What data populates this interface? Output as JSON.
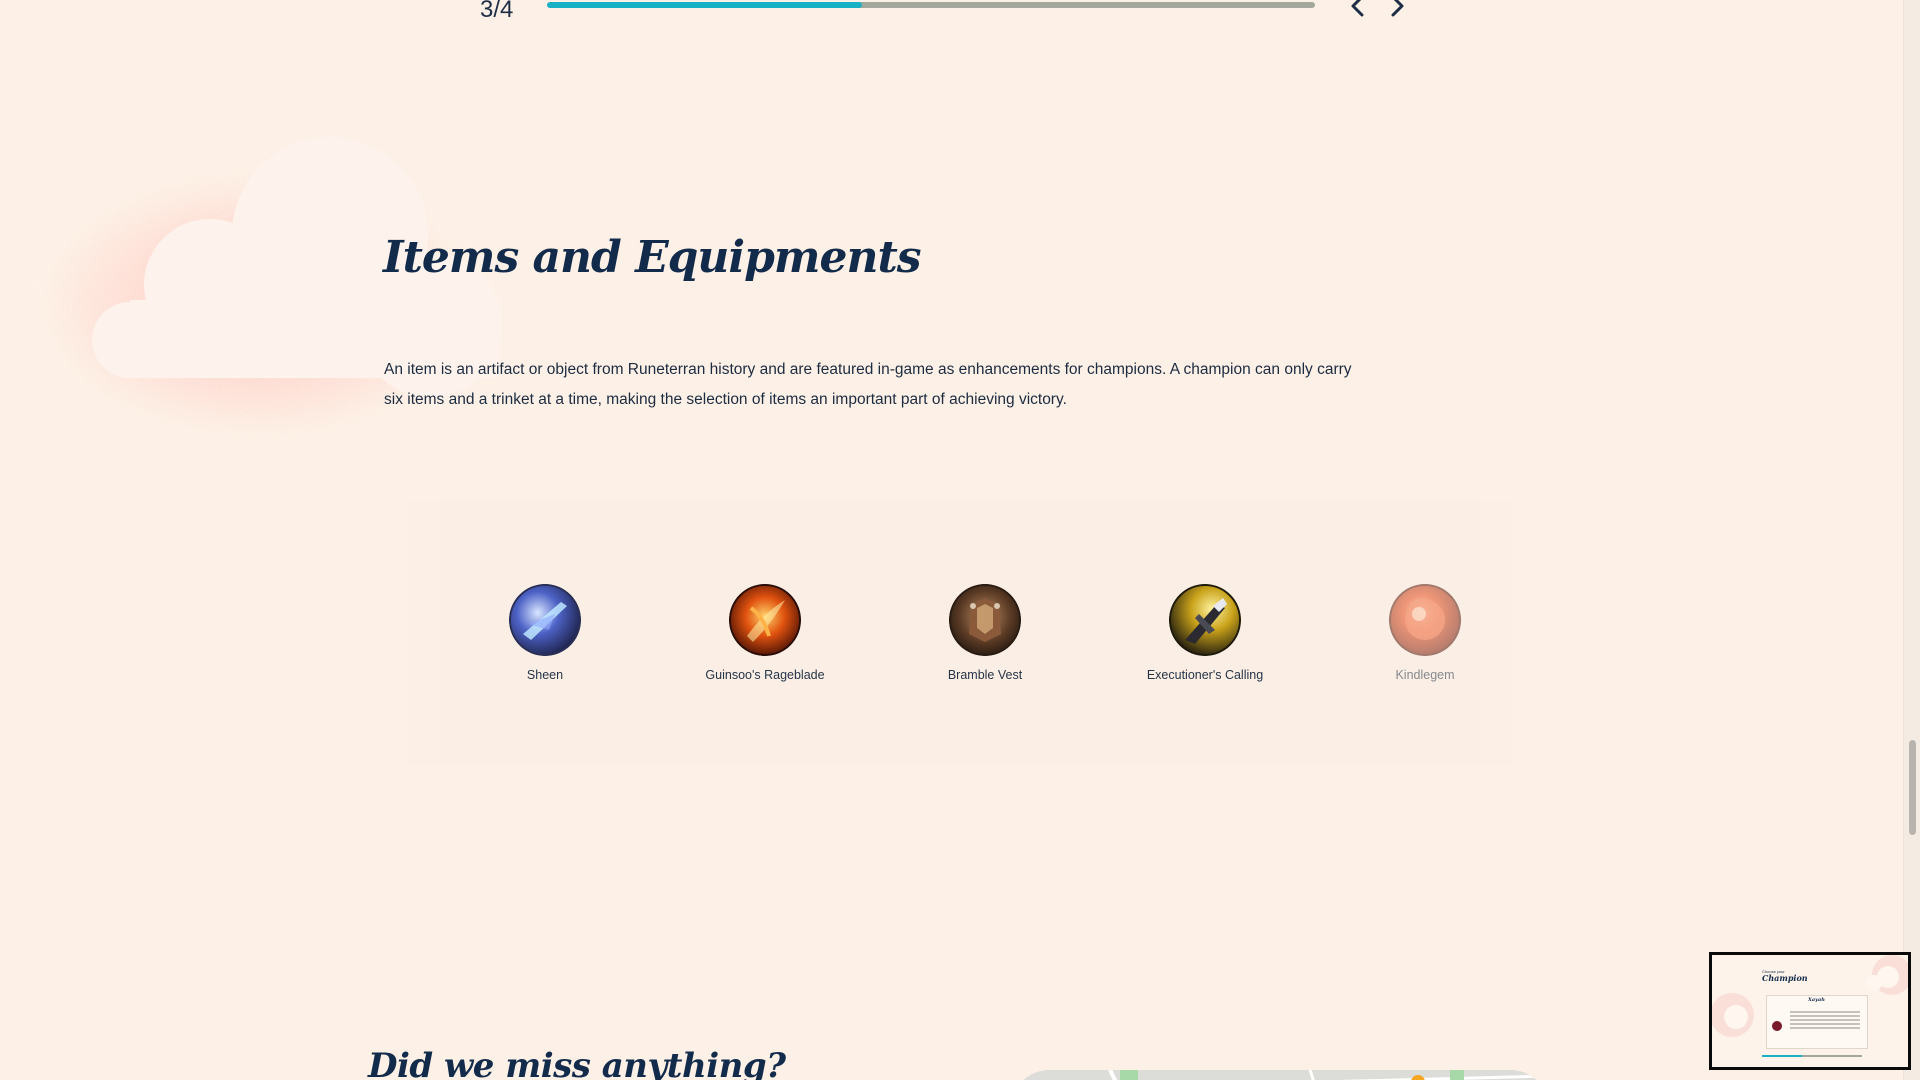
{
  "pager": {
    "count_text": "3/4",
    "progress": 0.41,
    "prev_icon": "chevron-left-icon",
    "next_icon": "chevron-right-icon"
  },
  "items_section": {
    "title": "Items and Equipments",
    "description": "An item is an artifact or object from Runeterran history and are featured in-game as enhancements for champions. A champion can only carry six items and a trinket at a time, making the selection of items an important part of achieving victory."
  },
  "items": [
    {
      "name": "Sheen",
      "icon": "sheen-icon"
    },
    {
      "name": "Guinsoo's Rageblade",
      "icon": "guinsoos-rageblade-icon"
    },
    {
      "name": "Bramble Vest",
      "icon": "bramble-vest-icon"
    },
    {
      "name": "Executioner's Calling",
      "icon": "executioners-calling-icon"
    },
    {
      "name": "Kindlegem",
      "icon": "kindlegem-icon"
    }
  ],
  "next_section": {
    "title": "Did we miss anything?"
  },
  "minimap": {
    "eyebrow": "Choose your",
    "title": "Champion",
    "card_name": "Xayah"
  },
  "colors": {
    "background": "#fdf1e7",
    "heading": "#132b4b",
    "progress_fill": "#18b0c4",
    "progress_track": "#a4a79b",
    "cloud_glow": "#f3b5b0"
  }
}
